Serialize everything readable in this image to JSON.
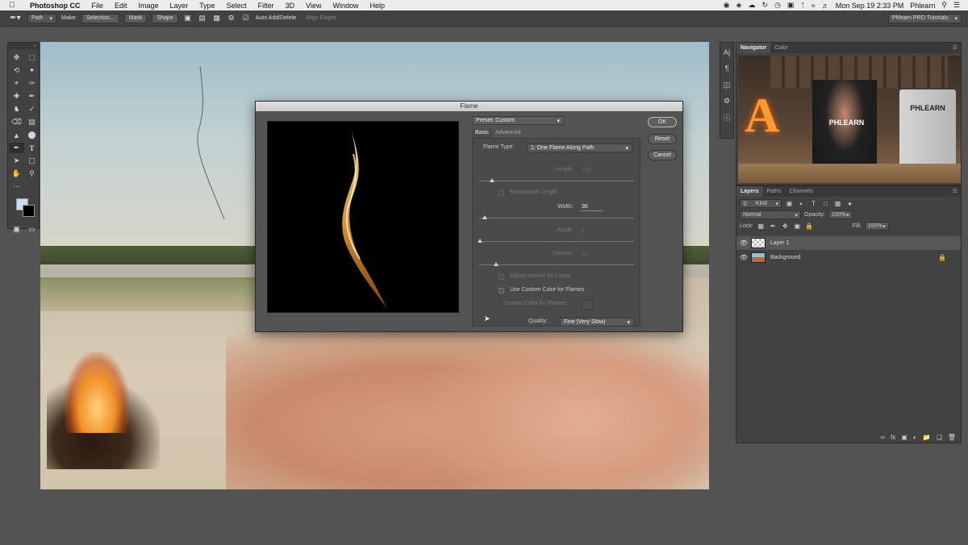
{
  "menubar": {
    "app": "Photoshop CC",
    "items": [
      "File",
      "Edit",
      "Image",
      "Layer",
      "Type",
      "Select",
      "Filter",
      "3D",
      "View",
      "Window",
      "Help"
    ],
    "clock": "Mon Sep 19  2:33 PM",
    "user": "Phlearn"
  },
  "options": {
    "mode": "Path",
    "make_label": "Make:",
    "selection_btn": "Selection...",
    "mask_btn": "Mask",
    "shape_btn": "Shape",
    "auto_add_delete": "Auto Add/Delete",
    "align_edges": "Align Edges",
    "workspace": "Phlearn PRO Tutorials"
  },
  "navigator": {
    "tabs": [
      "Navigator",
      "Color"
    ],
    "shirt_text": "PHLEARN",
    "monitor_text": "PHLEARN",
    "sign_letter": "A"
  },
  "layers": {
    "tabs": [
      "Layers",
      "Paths",
      "Channels"
    ],
    "filter_label": "Kind",
    "blend_mode": "Normal",
    "opacity_label": "Opacity:",
    "opacity_value": "100%",
    "lock_label": "Lock:",
    "fill_label": "Fill:",
    "fill_value": "100%",
    "items": [
      {
        "name": "Layer 1"
      },
      {
        "name": "Background"
      }
    ]
  },
  "dialog": {
    "title": "Flame",
    "preset": "Preset: Custom",
    "tabs": [
      "Basic",
      "Advanced"
    ],
    "flame_type_label": "Flame Type:",
    "flame_type_value": "1. One Flame Along Path",
    "length_label": "Length:",
    "length_value": "100",
    "randomize_label": "Randomize Length",
    "width_label": "Width:",
    "width_value": "36",
    "angle_label": "Angle:",
    "angle_value": "0",
    "interval_label": "Interval:",
    "interval_value": "30",
    "adjust_interval_label": "Adjust Interval for Loops",
    "custom_color_check_label": "Use Custom Color for Flames",
    "custom_color_label": "Custom Color for Flames:",
    "quality_label": "Quality:",
    "quality_value": "Fine (Very Slow)",
    "ok": "OK",
    "reset": "Reset",
    "cancel": "Cancel"
  },
  "colors": {
    "foreground": "#c8daf5",
    "background": "#000000"
  }
}
